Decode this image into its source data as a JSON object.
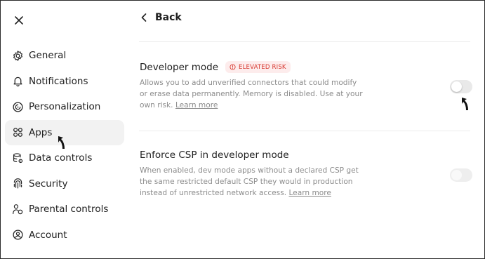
{
  "window": {
    "close_icon": "close-icon"
  },
  "header": {
    "back_label": "Back",
    "back_icon": "chevron-left-icon"
  },
  "sidebar": {
    "items": [
      {
        "label": "General",
        "icon": "gear-icon",
        "active": false
      },
      {
        "label": "Notifications",
        "icon": "bell-icon",
        "active": false
      },
      {
        "label": "Personalization",
        "icon": "personalization-icon",
        "active": false
      },
      {
        "label": "Apps",
        "icon": "apps-grid-icon",
        "active": true
      },
      {
        "label": "Data controls",
        "icon": "database-gear-icon",
        "active": false
      },
      {
        "label": "Security",
        "icon": "fingerprint-icon",
        "active": false
      },
      {
        "label": "Parental controls",
        "icon": "family-icon",
        "active": false
      },
      {
        "label": "Account",
        "icon": "account-icon",
        "active": false
      }
    ]
  },
  "settings": {
    "developer_mode": {
      "title": "Developer mode",
      "badge": "ELEVATED RISK",
      "desc": "Allows you to add unverified connectors that could modify or erase data permanently. Memory is disabled. Use at your own risk.",
      "link": "Learn more",
      "enabled": false
    },
    "enforce_csp": {
      "title": "Enforce CSP in developer mode",
      "desc": "When enabled, dev mode apps without a declared CSP get the same restricted default CSP they would in production instead of unrestricted network access.",
      "link": "Learn more",
      "enabled": false
    }
  },
  "colors": {
    "badge_text": "#d7372e",
    "badge_bg": "#fdecec",
    "active_bg": "#f2f2f2",
    "toggle_off": "#e9e9e9"
  }
}
